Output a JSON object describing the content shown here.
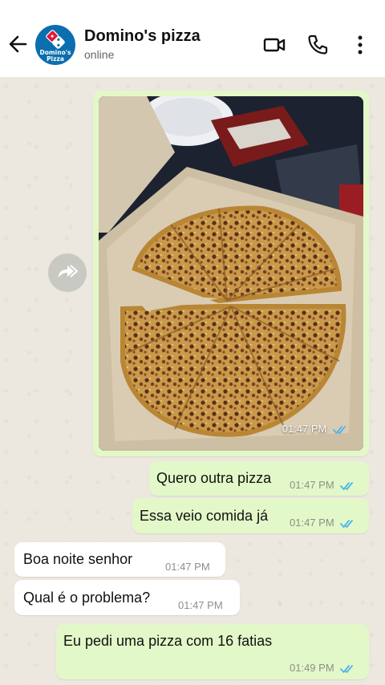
{
  "header": {
    "contact_name": "Domino's pizza",
    "status": "online",
    "logo_line1": "Domino's",
    "logo_line2": "Pizza",
    "icons": [
      "back-arrow-icon",
      "video-call-icon",
      "phone-icon",
      "more-vert-icon"
    ]
  },
  "messages": [
    {
      "direction": "out",
      "type": "image",
      "image_desc": "pizza-in-box",
      "time": "01:47 PM",
      "read": true
    },
    {
      "direction": "out",
      "text": "Quero outra pizza",
      "time": "01:47 PM",
      "read": true
    },
    {
      "direction": "out",
      "text": "Essa veio comida já",
      "time": "01:47 PM",
      "read": true
    },
    {
      "direction": "in",
      "text": "Boa noite senhor",
      "time": "01:47 PM"
    },
    {
      "direction": "in",
      "text": "Qual é o problema?",
      "time": "01:47 PM"
    },
    {
      "direction": "out",
      "text": "Eu pedi uma pizza com 16 fatias",
      "time": "01:49 PM",
      "read": true
    }
  ],
  "colors": {
    "outgoing_bubble": "#e3f8c8",
    "incoming_bubble": "#ffffff",
    "read_ticks": "#4fb6ec",
    "avatar_bg": "#0b6eae"
  }
}
